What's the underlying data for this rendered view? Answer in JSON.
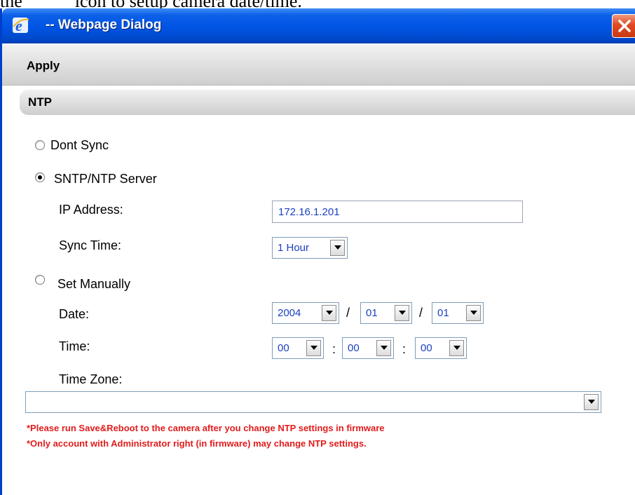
{
  "doc_caption": {
    "prefix": "the",
    "suffix": "icon to setup camera date/time."
  },
  "window": {
    "title": "-- Webpage Dialog",
    "icon": "ie-icon",
    "close_icon": "close-icon"
  },
  "toolbar": {
    "apply_label": "Apply"
  },
  "section": {
    "title": "NTP"
  },
  "sync_options": {
    "dont_sync_label": "Dont Sync",
    "sntp_label": "SNTP/NTP Server",
    "manual_label": "Set Manually",
    "selected": "SNTP/NTP Server"
  },
  "sntp": {
    "ip_label": "IP Address:",
    "ip_value": "172.16.1.201",
    "sync_time_label": "Sync Time:",
    "sync_time_value": "1 Hour"
  },
  "manual": {
    "date_label": "Date:",
    "year": "2004",
    "month": "01",
    "day": "01",
    "date_sep": "/",
    "time_label": "Time:",
    "hour": "00",
    "minute": "00",
    "second": "00",
    "time_sep": ":",
    "timezone_label": "Time Zone:",
    "timezone_value": ""
  },
  "notes": [
    "*Please run Save&Reboot to the camera after you change NTP settings in firmware",
    "*Only account with Administrator right (in firmware) may change NTP settings."
  ],
  "colors": {
    "titlebar": "#0054e3",
    "note_text": "#e21b1b",
    "input_text": "#1a3fbf"
  }
}
